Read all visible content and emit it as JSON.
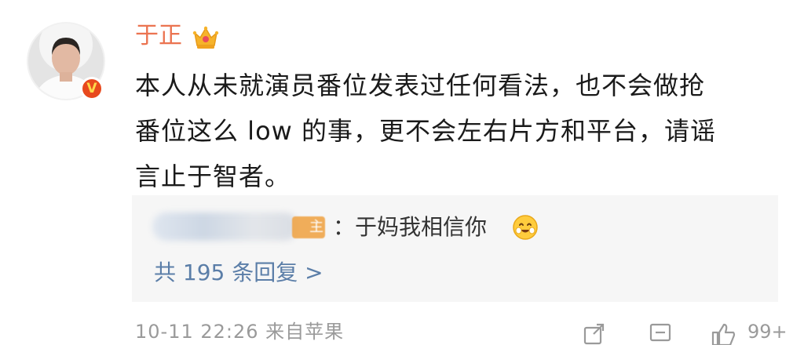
{
  "post": {
    "username": "于正",
    "verified_mark": "V",
    "text_lines": [
      "本人从未就演员番位发表过任何看法，也不会做抢",
      "番位这么 low 的事，更不会左右片方和平台，请谣",
      "言止于智者。"
    ]
  },
  "comment": {
    "reply_text": "：于妈我相信你",
    "badge_fragment": "主",
    "reply_count_label": "共 195 条回复 >"
  },
  "footer": {
    "timestamp": "10-11 22:26  来自苹果",
    "like_count": "99+"
  },
  "icons": {
    "crown": "crown-icon",
    "emoji": "smiling-face-icon",
    "share": "share-icon",
    "comment": "comment-icon",
    "like": "like-icon"
  },
  "colors": {
    "username": "#eb7350",
    "link": "#5b7ea8",
    "verified": "#e8491d",
    "comment_bg": "#f6f6f6"
  }
}
